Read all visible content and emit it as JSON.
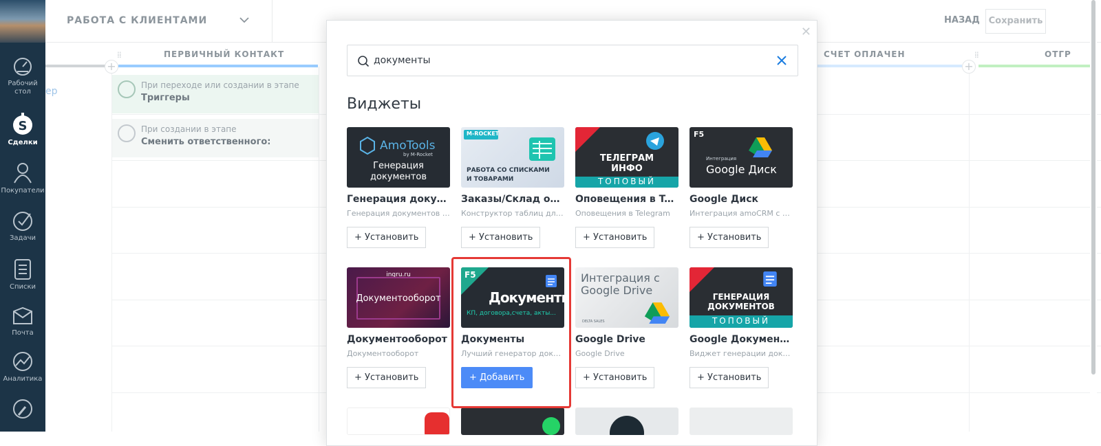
{
  "sidebar": {
    "items": [
      {
        "label": "Рабочий стол",
        "icon": "dashboard-icon"
      },
      {
        "label": "Сделки",
        "icon": "deals-icon"
      },
      {
        "label": "Покупатели",
        "icon": "customers-icon"
      },
      {
        "label": "Задачи",
        "icon": "tasks-icon"
      },
      {
        "label": "Списки",
        "icon": "lists-icon"
      },
      {
        "label": "Почта",
        "icon": "mail-icon"
      },
      {
        "label": "Аналитика",
        "icon": "analytics-icon"
      }
    ]
  },
  "header": {
    "pipeline_title": "РАБОТА С КЛИЕНТАМИ",
    "back_label": "НАЗАД",
    "save_label": "Сохранить"
  },
  "board": {
    "columns": [
      {
        "name": "ПЕРВИЧНЫЙ КОНТАКТ",
        "color": "#99ccff"
      },
      {
        "name": "СЧЕТ ОПЛАЧЕН",
        "color": "#d6eaff"
      },
      {
        "name": "ОТГР",
        "color": "#c1f0c1"
      }
    ],
    "partial_left_text": "ер",
    "triggers": [
      {
        "subtitle": "При переходе или создании в этапе",
        "title": "Триггеры"
      },
      {
        "subtitle": "При создании в этапе",
        "title": "Сменить ответственного:"
      }
    ]
  },
  "modal": {
    "search_value": "документы",
    "section_title": "Виджеты",
    "widgets": [
      {
        "title": "Генерация документов AmoTools",
        "desc": "Генерация документов на основе шаблонов",
        "button": "+ Установить",
        "img": {
          "brand": "AmoTools",
          "by": "by M-Rocket",
          "line1": "Генерация",
          "line2": "документов"
        }
      },
      {
        "title": "Заказы/Склад от M-Rocket",
        "desc": "Конструктор таблиц для сделок",
        "button": "+ Установить",
        "img": {
          "brand": "M-ROCKET",
          "line1": "РАБОТА СО СПИСКАМИ",
          "line2": "И ТОВАРАМИ"
        }
      },
      {
        "title": "Оповещения в Telegram",
        "desc": "Оповещения в Telegram",
        "button": "+ Установить",
        "img": {
          "line1": "ТЕЛЕГРАМ",
          "line2": "ИНФО",
          "ribbon": "ТОПОВЫЙ"
        }
      },
      {
        "title": "Google Диск",
        "desc": "Интеграция amoCRM с Google Диском",
        "button": "+ Установить",
        "img": {
          "tag": "F5",
          "small": "Интеграция",
          "brand": "Google Диск"
        }
      },
      {
        "title": "Документооборот",
        "desc": "Документооборот",
        "button": "+ Установить",
        "img": {
          "small": "ingru.ru",
          "line1": "Документооборот"
        }
      },
      {
        "title": "Документы",
        "desc": "Лучший генератор документов",
        "button": "+ Добавить",
        "img": {
          "tag": "F5",
          "line1": "Документы",
          "line2": "КП, договора,счета, акты..."
        }
      },
      {
        "title": "Google Drive",
        "desc": "Google Drive",
        "button": "+ Установить",
        "img": {
          "line1": "Интеграция с",
          "line2": "Google Drive",
          "small": "DELTA SALES"
        }
      },
      {
        "title": "Google Документы генерация",
        "desc": "Виджет генерации документов",
        "button": "+ Установить",
        "img": {
          "line1": "ГЕНЕРАЦИЯ",
          "line2": "ДОКУМЕНТОВ",
          "ribbon": "ТОПОВЫЙ"
        }
      }
    ]
  },
  "colors": {
    "sidebar": "#1c3447",
    "accent": "#4c8bf7",
    "highlight": "#e53935"
  }
}
